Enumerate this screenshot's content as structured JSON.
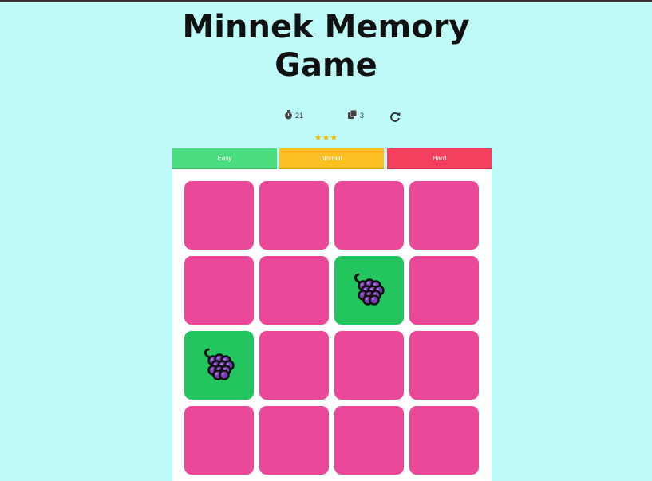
{
  "title": {
    "line1": "Minnek Memory",
    "line2": "Game"
  },
  "stats": {
    "timer_icon": "stopwatch-icon",
    "timer_value": "21",
    "moves_icon": "cards-icon",
    "moves_value": "3",
    "restart_icon": "restart-icon"
  },
  "rating": {
    "stars": "★★★",
    "count": 3,
    "color": "#f5b800"
  },
  "levels": [
    {
      "label": "Easy",
      "color": "#4ade80"
    },
    {
      "label": "Normal",
      "color": "#fbbf24"
    },
    {
      "label": "Hard",
      "color": "#f43f5e"
    }
  ],
  "board": {
    "card_back_color": "#ec4899",
    "card_open_color": "#22c55e",
    "cards": [
      {
        "state": "hidden",
        "icon": ""
      },
      {
        "state": "hidden",
        "icon": ""
      },
      {
        "state": "hidden",
        "icon": ""
      },
      {
        "state": "hidden",
        "icon": ""
      },
      {
        "state": "hidden",
        "icon": ""
      },
      {
        "state": "hidden",
        "icon": ""
      },
      {
        "state": "open",
        "icon": "grapes-icon"
      },
      {
        "state": "hidden",
        "icon": ""
      },
      {
        "state": "open",
        "icon": "grapes-icon"
      },
      {
        "state": "hidden",
        "icon": ""
      },
      {
        "state": "hidden",
        "icon": ""
      },
      {
        "state": "hidden",
        "icon": ""
      },
      {
        "state": "hidden",
        "icon": ""
      },
      {
        "state": "hidden",
        "icon": ""
      },
      {
        "state": "hidden",
        "icon": ""
      },
      {
        "state": "hidden",
        "icon": ""
      }
    ]
  }
}
